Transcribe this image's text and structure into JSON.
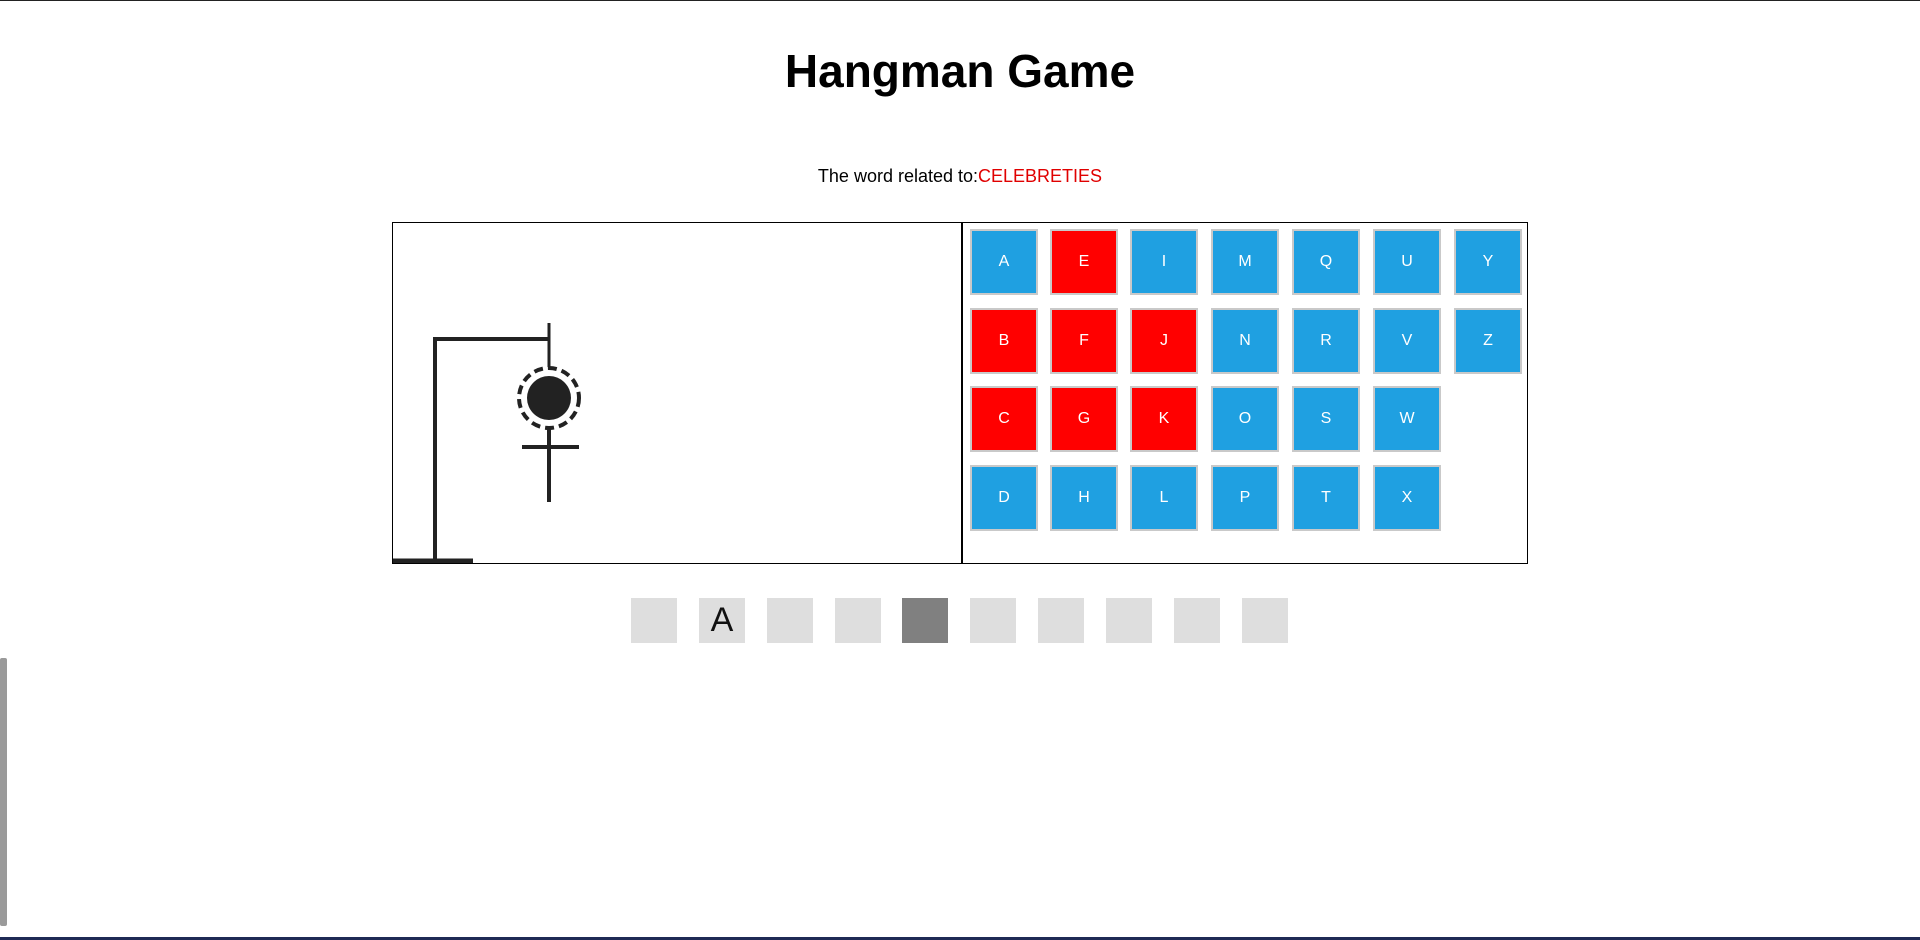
{
  "title": "Hangman Game",
  "category": {
    "prefix": "The word related to:",
    "value": "CELEBRETIES"
  },
  "colors": {
    "available": "#1fa0e1",
    "wrong": "#ff0000",
    "slot": "#dedede",
    "slot_active": "#808080"
  },
  "letters": [
    {
      "char": "A",
      "state": "available"
    },
    {
      "char": "B",
      "state": "wrong"
    },
    {
      "char": "C",
      "state": "wrong"
    },
    {
      "char": "D",
      "state": "available"
    },
    {
      "char": "E",
      "state": "wrong"
    },
    {
      "char": "F",
      "state": "wrong"
    },
    {
      "char": "G",
      "state": "wrong"
    },
    {
      "char": "H",
      "state": "available"
    },
    {
      "char": "I",
      "state": "available"
    },
    {
      "char": "J",
      "state": "wrong"
    },
    {
      "char": "K",
      "state": "wrong"
    },
    {
      "char": "L",
      "state": "available"
    },
    {
      "char": "M",
      "state": "available"
    },
    {
      "char": "N",
      "state": "available"
    },
    {
      "char": "O",
      "state": "available"
    },
    {
      "char": "P",
      "state": "available"
    },
    {
      "char": "Q",
      "state": "available"
    },
    {
      "char": "R",
      "state": "available"
    },
    {
      "char": "S",
      "state": "available"
    },
    {
      "char": "T",
      "state": "available"
    },
    {
      "char": "U",
      "state": "available"
    },
    {
      "char": "V",
      "state": "available"
    },
    {
      "char": "W",
      "state": "available"
    },
    {
      "char": "X",
      "state": "available"
    },
    {
      "char": "Y",
      "state": "available"
    },
    {
      "char": "Z",
      "state": "available"
    }
  ],
  "word_slots": [
    {
      "char": "",
      "active": false
    },
    {
      "char": "A",
      "active": false
    },
    {
      "char": "",
      "active": false
    },
    {
      "char": "",
      "active": false
    },
    {
      "char": "",
      "active": true
    },
    {
      "char": "",
      "active": false
    },
    {
      "char": "",
      "active": false
    },
    {
      "char": "",
      "active": false
    },
    {
      "char": "",
      "active": false
    },
    {
      "char": "",
      "active": false
    }
  ]
}
